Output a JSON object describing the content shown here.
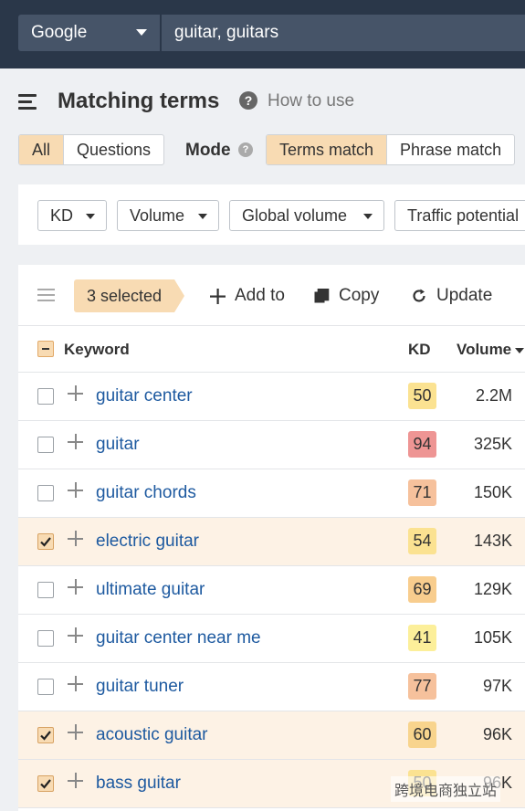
{
  "search": {
    "engine": "Google",
    "query": "guitar, guitars"
  },
  "header": {
    "title": "Matching terms",
    "help_link": "How to use"
  },
  "type_tabs": [
    {
      "label": "All",
      "active": true
    },
    {
      "label": "Questions",
      "active": false
    }
  ],
  "mode": {
    "label": "Mode",
    "options": [
      {
        "label": "Terms match",
        "active": true
      },
      {
        "label": "Phrase match",
        "active": false
      }
    ]
  },
  "filters": [
    "KD",
    "Volume",
    "Global volume",
    "Traffic potential"
  ],
  "toolbar": {
    "selected": "3 selected",
    "add_to": "Add to",
    "copy": "Copy",
    "update": "Update"
  },
  "table": {
    "columns": {
      "keyword": "Keyword",
      "kd": "KD",
      "volume": "Volume"
    },
    "rows": [
      {
        "keyword": "guitar center",
        "kd": "50",
        "volume": "2.2M",
        "selected": false,
        "kd_color": "#fbe291"
      },
      {
        "keyword": "guitar",
        "kd": "94",
        "volume": "325K",
        "selected": false,
        "kd_color": "#ee9594"
      },
      {
        "keyword": "guitar chords",
        "kd": "71",
        "volume": "150K",
        "selected": false,
        "kd_color": "#f6c19c"
      },
      {
        "keyword": "electric guitar",
        "kd": "54",
        "volume": "143K",
        "selected": true,
        "kd_color": "#fbe291"
      },
      {
        "keyword": "ultimate guitar",
        "kd": "69",
        "volume": "129K",
        "selected": false,
        "kd_color": "#f8cd8e"
      },
      {
        "keyword": "guitar center near me",
        "kd": "41",
        "volume": "105K",
        "selected": false,
        "kd_color": "#fcef9a"
      },
      {
        "keyword": "guitar tuner",
        "kd": "77",
        "volume": "97K",
        "selected": false,
        "kd_color": "#f6c19c"
      },
      {
        "keyword": "acoustic guitar",
        "kd": "60",
        "volume": "96K",
        "selected": true,
        "kd_color": "#f8d48d"
      },
      {
        "keyword": "bass guitar",
        "kd": "50",
        "volume": "96K",
        "selected": true,
        "kd_color": "#fbe291"
      }
    ]
  },
  "watermark": "跨境电商独立站",
  "colors": {
    "accent_orange": "#f8dbb3",
    "link_blue": "#1e5aa0",
    "topbar": "#2a3749"
  }
}
